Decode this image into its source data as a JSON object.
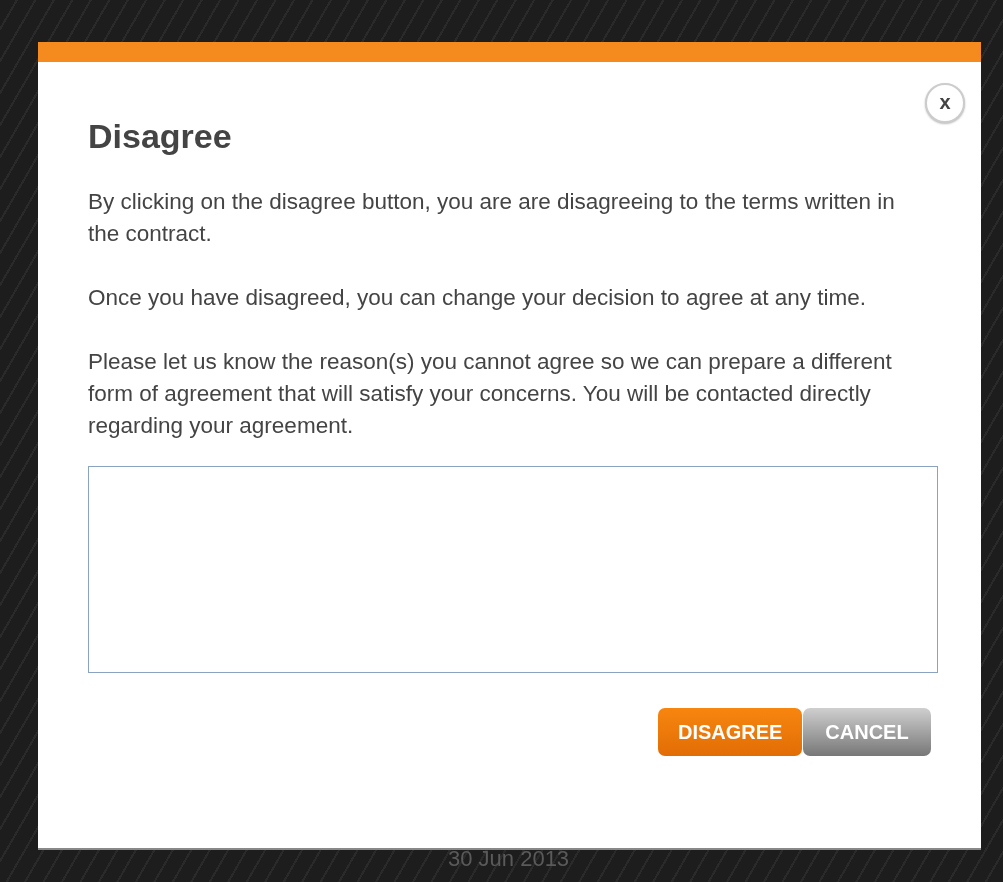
{
  "background": {
    "date": "30 Jun 2013"
  },
  "dialog": {
    "title": "Disagree",
    "paragraphs": [
      "By clicking on the disagree button, you are are disagreeing to the terms written in the contract.",
      "Once you have disagreed, you can change your decision to agree at any time.",
      "Please let us know the reason(s) you cannot agree so we can prepare a different form of agreement that will satisfy your concerns. You will be contacted directly regarding your agreement."
    ],
    "close": "x",
    "buttons": [
      {
        "label": "DISAGREE",
        "kind": "primary"
      },
      {
        "label": "CANCEL",
        "kind": "secondary"
      }
    ]
  }
}
